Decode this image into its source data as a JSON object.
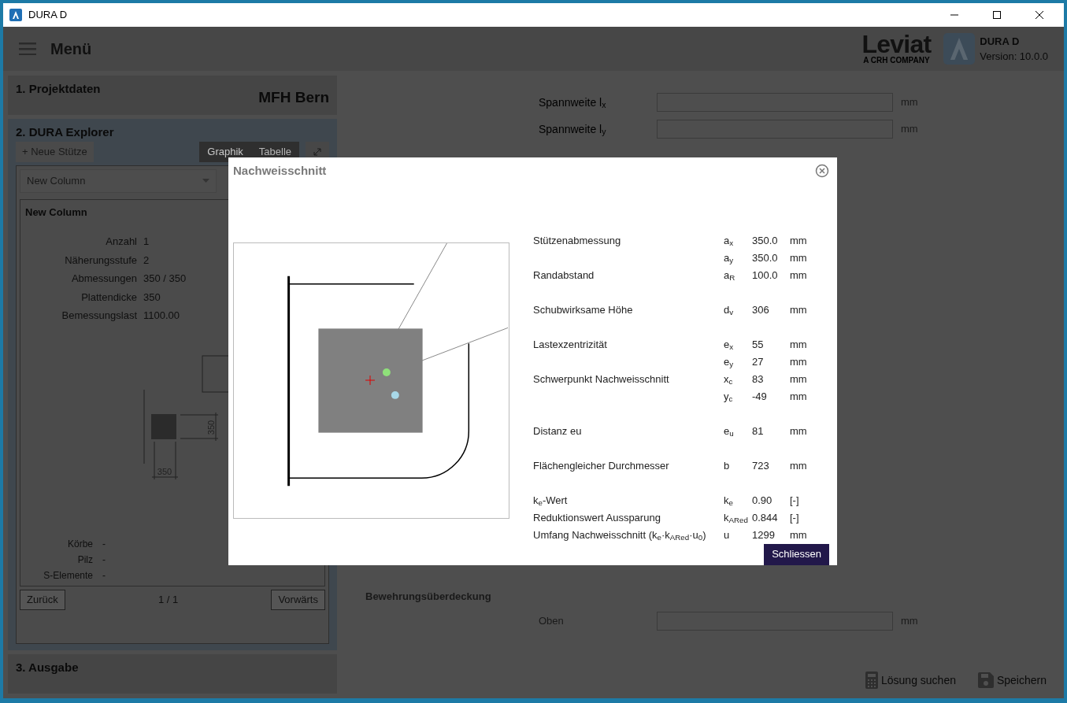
{
  "window": {
    "title": "DURA D"
  },
  "header": {
    "menu_label": "Menü",
    "brand": "Leviat",
    "brand_sub": "A CRH COMPANY",
    "product": "DURA D",
    "version": "Version: 10.0.0"
  },
  "sections": [
    {
      "title": "1. Projektdaten",
      "value": "MFH Bern",
      "expanded": false
    },
    {
      "title": "2. DURA Explorer",
      "expanded": true
    },
    {
      "title": "3. Ausgabe",
      "expanded": false
    }
  ],
  "explorer": {
    "new_button": "+ Neue Stütze",
    "views": [
      {
        "label": "Graphik",
        "selected": true
      },
      {
        "label": "Tabelle",
        "selected": false
      }
    ],
    "dropdown": "New Column",
    "card_title": "New Column",
    "properties": [
      {
        "label": "Anzahl",
        "value": "1"
      },
      {
        "label": "Näherungsstufe",
        "value": "2"
      },
      {
        "label": "Abmessungen",
        "value": "350 / 350"
      },
      {
        "label": "Plattendicke",
        "value": "350"
      },
      {
        "label": "Bemessungslast",
        "value": "1100.00"
      }
    ],
    "dims": [
      "350",
      "350"
    ],
    "extras": [
      {
        "label": "Körbe",
        "value": "-"
      },
      {
        "label": "Pilz",
        "value": "-"
      },
      {
        "label": "S-Elemente",
        "value": "-"
      }
    ],
    "back": "Zurück",
    "pager": "1 / 1",
    "forward": "Vorwärts"
  },
  "form": {
    "fields": [
      {
        "label": "Spannweite l$_{x}$",
        "unit": "mm"
      },
      {
        "label": "Spannweite l$_{y}$",
        "unit": "mm"
      }
    ],
    "cover_title": "Bewehrungsüberdeckung",
    "cover_fields": [
      {
        "label": "Oben",
        "unit": "mm"
      }
    ]
  },
  "footer": {
    "buttons": [
      {
        "kind": "calculator",
        "label": "Lösung suchen"
      },
      {
        "kind": "save",
        "label": "Speichern"
      }
    ]
  },
  "dialog": {
    "title": "Nachweisschnitt",
    "close": "Schliessen",
    "groups": [
      [
        {
          "label": "Stützenabmessung",
          "symbol": "a$_{x}$",
          "value": "350.0",
          "unit": "mm"
        },
        {
          "symbol": "a$_{y}$",
          "value": "350.0",
          "unit": "mm"
        },
        {
          "label": "Randabstand",
          "symbol": "a$_{R}$",
          "value": "100.0",
          "unit": "mm"
        }
      ],
      [
        {
          "label": "Schubwirksame Höhe",
          "symbol": "d$_{v}$",
          "value": "306",
          "unit": "mm"
        }
      ],
      [
        {
          "label": "Lastexzentrizität",
          "symbol": "e$_{x}$",
          "value": "55",
          "unit": "mm"
        },
        {
          "symbol": "e$_{y}$",
          "value": "27",
          "unit": "mm"
        },
        {
          "label": "Schwerpunkt Nachweisschnitt",
          "symbol": "x$_{c}$",
          "value": "83",
          "unit": "mm"
        },
        {
          "symbol": "y$_{c}$",
          "value": "-49",
          "unit": "mm"
        }
      ],
      [
        {
          "label": "Distanz eu",
          "symbol": "e$_{u}$",
          "value": "81",
          "unit": "mm"
        }
      ],
      [
        {
          "label": "Flächengleicher Durchmesser",
          "symbol": "b",
          "value": "723",
          "unit": "mm"
        }
      ],
      [
        {
          "label": "k$_{e}$-Wert",
          "symbol": "k$_{e}$",
          "value": "0.90",
          "unit": "[-]"
        },
        {
          "label": "Reduktionswert Aussparung",
          "symbol": "k$_{ARed}$",
          "value": "0.844",
          "unit": "[-]"
        },
        {
          "label": "Umfang Nachweisschnitt (k$_{e}$·k$_{ARed}$·u$_{0}$)",
          "symbol": "u",
          "value": "1299",
          "unit": "mm"
        }
      ]
    ]
  }
}
